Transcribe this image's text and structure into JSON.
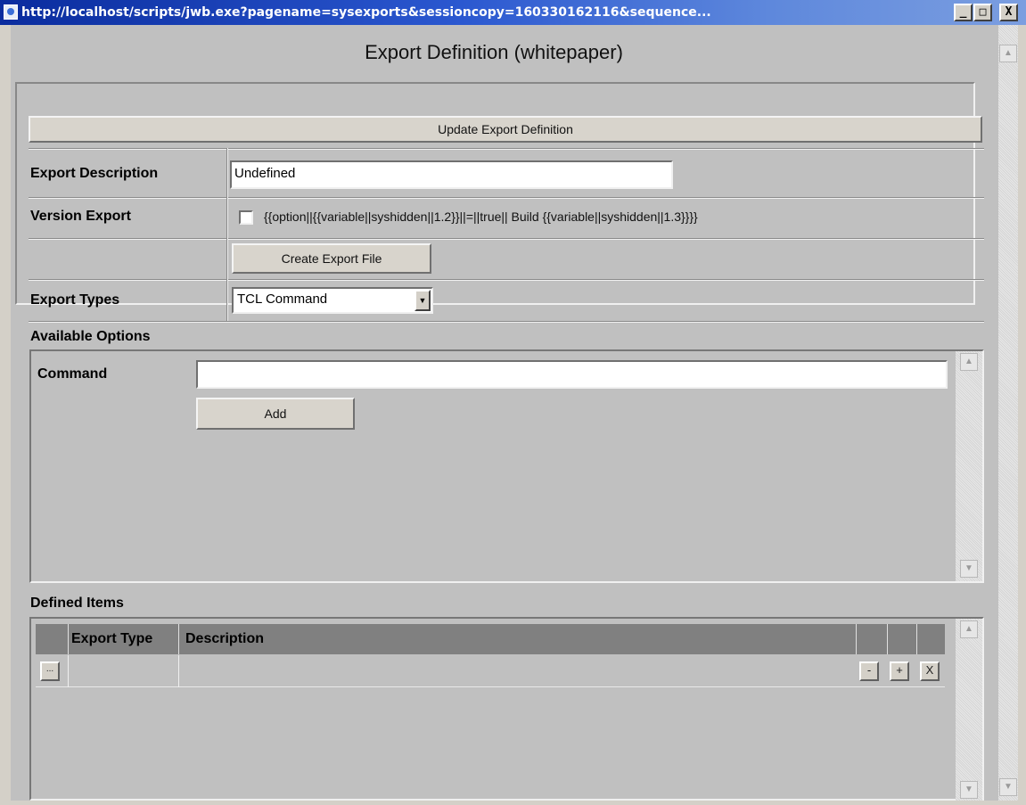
{
  "window": {
    "title": "http://localhost/scripts/jwb.exe?pagename=sysexports&sessioncopy=160330162116&sequence...",
    "controls": {
      "minimize": "_",
      "maximize": "□",
      "close": "X"
    }
  },
  "page": {
    "title": "Export Definition (whitepaper)",
    "update_button": "Update Export Definition"
  },
  "form": {
    "description_label": "Export Description",
    "description_value": "Undefined",
    "version_label": "Version Export",
    "version_checked": false,
    "version_text": "{{option||{{variable||syshidden||1.2}}||=||true||  Build {{variable||syshidden||1.3}}}}",
    "create_button": "Create Export File",
    "types_label": "Export Types",
    "types_selected": "TCL Command"
  },
  "available_options": {
    "heading": "Available Options",
    "command_label": "Command",
    "command_value": "",
    "add_button": "Add"
  },
  "defined_items": {
    "heading": "Defined Items",
    "columns": [
      "Export Type",
      "Description"
    ],
    "row": {
      "open_button": "...",
      "export_type": "",
      "description": "",
      "minus_button": "-",
      "plus_button": "+",
      "delete_button": "X"
    }
  },
  "icons": [
    "app-icon",
    "scroll-up-icon",
    "scroll-down-icon",
    "dropdown-arrow-icon"
  ]
}
